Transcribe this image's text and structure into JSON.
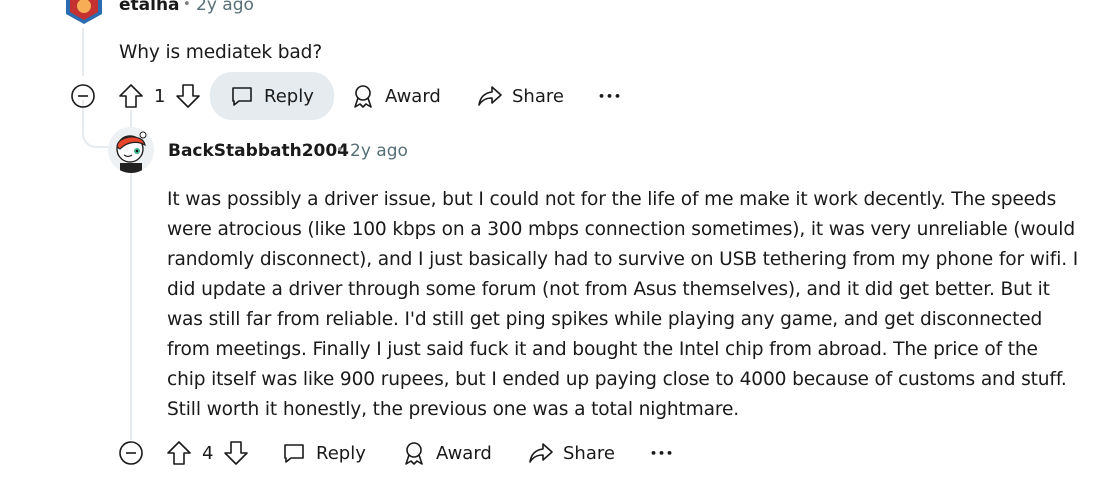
{
  "comment1": {
    "username": "etalha",
    "separator": "•",
    "time": "2y ago",
    "body": "Why is mediatek bad?",
    "vote_count": "1",
    "reply_label": "Reply",
    "award_label": "Award",
    "share_label": "Share",
    "more_label": "•••"
  },
  "comment2": {
    "username": "BackStabbath2004",
    "separator": "•",
    "time": "2y ago",
    "body_lines": [
      "It was possibly a driver issue, but I could not for the life of me make it work decently. The speeds",
      "were atrocious (like 100 kbps on a 300 mbps connection sometimes), it was very unreliable (would",
      "randomly disconnect), and I just basically had to survive on USB tethering from my phone for wifi. I",
      "did update a driver through some forum (not from Asus themselves), and it did get better. But it",
      "was still far from reliable. I'd still get ping spikes while playing any game, and get disconnected",
      "from meetings. Finally I just said fuck it and bought the Intel chip from abroad. The price of the",
      "chip itself was like 900 rupees, but I ended up paying close to 4000 because of customs and stuff.",
      "Still worth it honestly, the previous one was a total nightmare."
    ],
    "vote_count": "4",
    "reply_label": "Reply",
    "award_label": "Award",
    "share_label": "Share",
    "more_label": "•••"
  },
  "icons": [
    "collapse-icon",
    "upvote-icon",
    "downvote-icon",
    "comment-icon",
    "award-icon",
    "share-icon",
    "more-icon"
  ]
}
